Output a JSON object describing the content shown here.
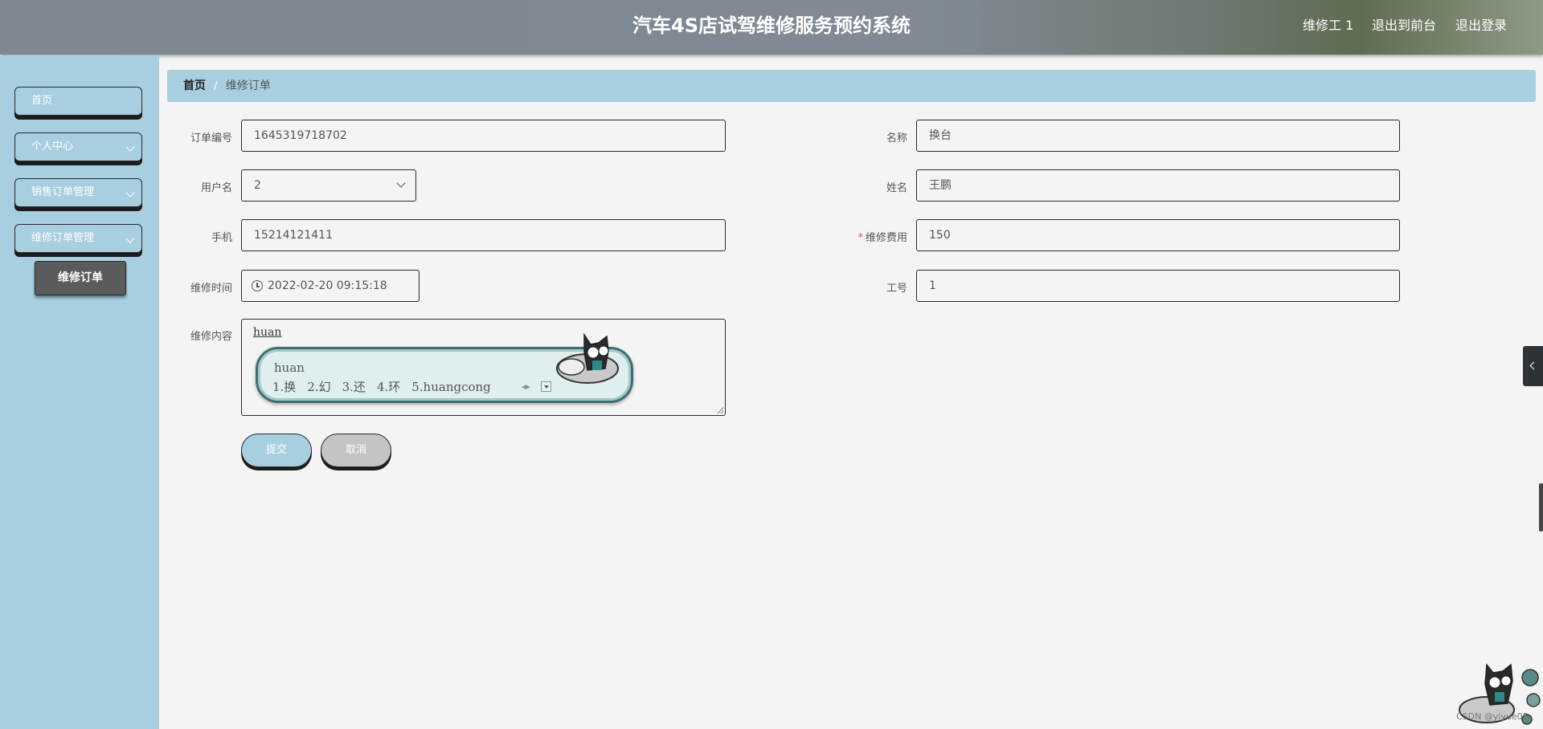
{
  "header": {
    "title": "汽车4S店试驾维修服务预约系统",
    "user": "维修工 1",
    "back_front": "退出到前台",
    "logout": "退出登录"
  },
  "sidebar": {
    "items": [
      {
        "label": "首页"
      },
      {
        "label": "个人中心"
      },
      {
        "label": "销售订单管理"
      },
      {
        "label": "维修订单管理"
      }
    ],
    "sub_item": "维修订单"
  },
  "breadcrumb": {
    "home": "首页",
    "separator": "/",
    "current": "维修订单"
  },
  "form": {
    "order_no": {
      "label": "订单编号",
      "value": "1645319718702"
    },
    "name": {
      "label": "名称",
      "value": "换台"
    },
    "username": {
      "label": "用户名",
      "value": "2"
    },
    "realname": {
      "label": "姓名",
      "value": "王鹏"
    },
    "phone": {
      "label": "手机",
      "value": "15214121411"
    },
    "fee": {
      "label": "维修费用",
      "required": "*",
      "value": "150"
    },
    "time": {
      "label": "维修时间",
      "value": "2022-02-20 09:15:18"
    },
    "job_no": {
      "label": "工号",
      "value": "1"
    },
    "content": {
      "label": "维修内容",
      "value": "huan"
    }
  },
  "ime": {
    "composition": "huan",
    "candidates": [
      "1.换",
      "2.幻",
      "3.还",
      "4.环",
      "5.huangcong"
    ]
  },
  "buttons": {
    "submit": "提交",
    "cancel": "取消"
  },
  "credit": "CSDN @yiyue05",
  "colors": {
    "accent": "#a8cfe0",
    "header": "#7e8790",
    "dark_button": "#5b5b5b",
    "required": "#e05a47"
  }
}
